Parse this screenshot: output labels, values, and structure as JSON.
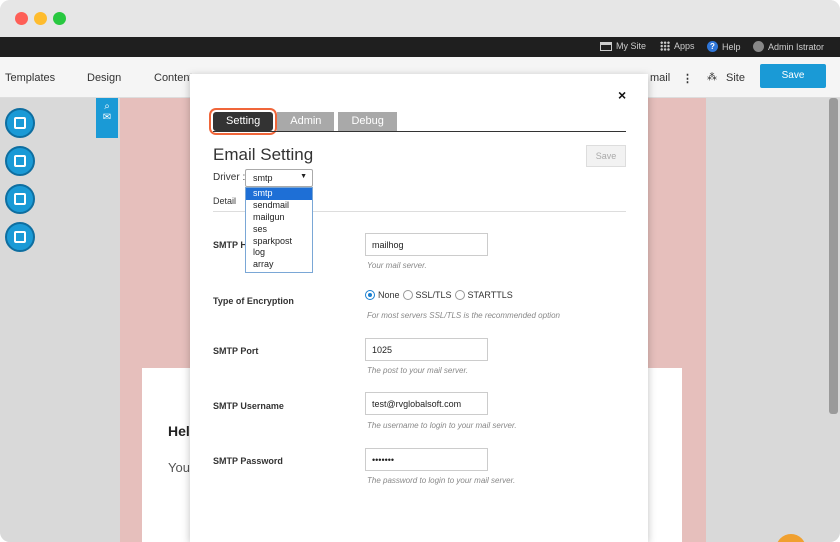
{
  "topbar": {
    "my_site": "My Site",
    "apps": "Apps",
    "help": "Help",
    "user": "Admin Istrator"
  },
  "editor": {
    "templates": "Templates",
    "design": "Design",
    "content": "Content",
    "email": "mail",
    "site": "Site",
    "save": "Save"
  },
  "background_card": {
    "heading": "Hel",
    "text": "You"
  },
  "modal": {
    "close": "×",
    "tabs": [
      "Setting",
      "Admin",
      "Debug"
    ],
    "active_tab": "Setting",
    "title": "Email Setting",
    "save_label": "Save",
    "driver_label": "Driver :",
    "driver_value": "smtp",
    "driver_options": [
      "smtp",
      "sendmail",
      "mailgun",
      "ses",
      "sparkpost",
      "log",
      "array"
    ],
    "detail_label": "Detail",
    "fields": {
      "host": {
        "label": "SMTP H",
        "value": "mailhog",
        "help": "Your mail server."
      },
      "encryption": {
        "label": "Type of Encryption",
        "options": [
          "None",
          "SSL/TLS",
          "STARTTLS"
        ],
        "selected": "None",
        "help": "For most servers SSL/TLS is the recommended option"
      },
      "port": {
        "label": "SMTP Port",
        "value": "1025",
        "help": "The post to your mail server."
      },
      "username": {
        "label": "SMTP Username",
        "value": "test@rvglobalsoft.com",
        "help": "The username to login to your mail server."
      },
      "password": {
        "label": "SMTP Password",
        "value": "•••••••",
        "help": "The password to login to your mail server."
      }
    }
  },
  "colors": {
    "accent": "#1a9ad6",
    "tab_highlight": "#f0663a",
    "canvas": "#e6bfbc"
  }
}
